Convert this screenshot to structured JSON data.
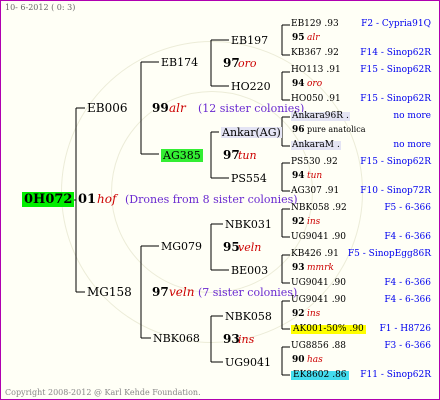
{
  "header": "10- 6-2012 ( 0: 3)",
  "footer": "Copyright 2008-2012 @ Karl Kehde Foundation.",
  "root": {
    "id": "0H072",
    "num": "01",
    "breeder": "hof",
    "note": "(Drones from 8 sister colonies)"
  },
  "dam": {
    "id": "EB006",
    "num": "99",
    "breeder": "alr",
    "note": "(12 sister colonies)"
  },
  "sire": {
    "id": "MG158",
    "num": "97",
    "breeder": "veln",
    "note": "(7 sister colonies)"
  },
  "gen3": [
    {
      "id": "EB174"
    },
    {
      "id": "AG385"
    },
    {
      "id": "MG079",
      "num": "95",
      "breeder": "veln"
    },
    {
      "id": "NBK068",
      "num": "93",
      "breeder": "ins"
    }
  ],
  "gen4": [
    {
      "id": "EB197"
    },
    {
      "id": "HO220"
    },
    {
      "id": "Ankar(AG)"
    },
    {
      "id": "PS554"
    },
    {
      "id": "NBK031"
    },
    {
      "id": "BE003"
    },
    {
      "id": "NBK058"
    },
    {
      "id": "UG9041"
    }
  ],
  "gen3_numbers": [
    {
      "num": "97",
      "breeder": "oro"
    },
    {
      "num": "97",
      "breeder": "tun"
    }
  ],
  "gen5": [
    {
      "id": "EB129",
      "year": ".93",
      "breed": "F2 - Cypria91Q"
    },
    {
      "id": "95",
      "breeder": "alr",
      "row": "num"
    },
    {
      "id": "KB367",
      "year": ".92",
      "breed": "F14 - Sinop62R"
    },
    {
      "id": "HO113",
      "year": ".91",
      "breed": "F15 - Sinop62R"
    },
    {
      "id": "94",
      "breeder": "oro",
      "row": "num"
    },
    {
      "id": "HO050",
      "year": ".91",
      "breed": "F15 - Sinop62R"
    },
    {
      "id": "Ankara96R",
      "year": ".",
      "breed": "no more"
    },
    {
      "id": "96",
      "breeder": "pure anatolica",
      "row": "num"
    },
    {
      "id": "AnkaraM",
      "year": ".",
      "breed": "no more"
    },
    {
      "id": "PS530",
      "year": ".92",
      "breed": "F15 - Sinop62R"
    },
    {
      "id": "94",
      "breeder": "tun",
      "row": "num"
    },
    {
      "id": "AG307",
      "year": ".91",
      "breed": "F10 - Sinop72R"
    },
    {
      "id": "NBK058",
      "year": ".92",
      "breed": "F5 - 6-366"
    },
    {
      "id": "92",
      "breeder": "ins",
      "row": "num"
    },
    {
      "id": "UG9041",
      "year": ".90",
      "breed": "F4 - 6-366"
    },
    {
      "id": "KB426",
      "year": ".91",
      "breed": "F5 - SinopEgg86R"
    },
    {
      "id": "93",
      "breeder": "mmrk",
      "row": "num"
    },
    {
      "id": "UG9041",
      "year": ".90",
      "breed": "F4 - 6-366"
    },
    {
      "id": "UG9041",
      "year": ".90",
      "breed": "F4 - 6-366"
    },
    {
      "id": "92",
      "breeder": "ins",
      "row": "num"
    },
    {
      "id": "AK001-50%",
      "year": ".90",
      "breed": "F1 - H8726"
    },
    {
      "id": "UG8856",
      "year": ".88",
      "breed": "F3 - 6-366"
    },
    {
      "id": "90",
      "breeder": "has",
      "row": "num"
    },
    {
      "id": "EK8602",
      "year": ".86",
      "breed": "F11 - Sinop62R"
    }
  ]
}
